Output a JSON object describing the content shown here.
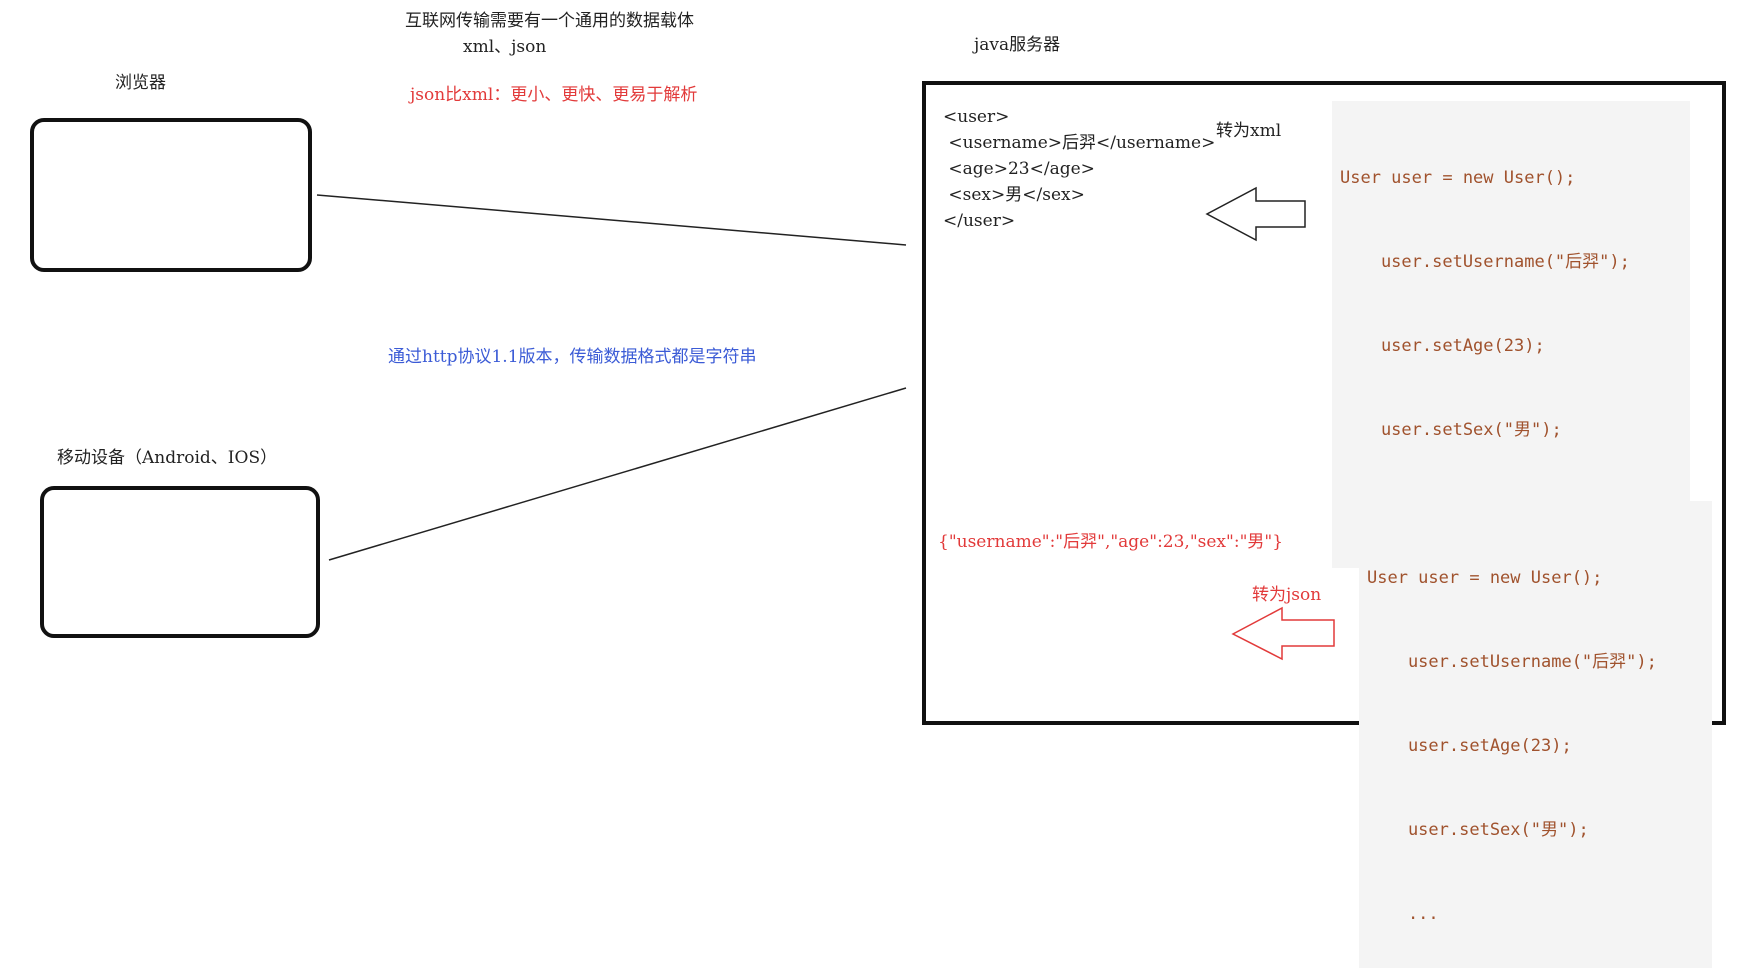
{
  "header": {
    "line1": "互联网传输需要有一个通用的数据载体",
    "line2": "xml、json",
    "comparison": "json比xml：更小、更快、更易于解析"
  },
  "server": {
    "title": "java服务器"
  },
  "browser": {
    "label": "浏览器"
  },
  "mobile": {
    "label": "移动设备（Android、IOS）"
  },
  "transport_note": "通过http协议1.1版本，传输数据格式都是字符串",
  "xml_block": {
    "lines": [
      "<user>",
      " <username>后羿</username>",
      " <age>23</age>",
      " <sex>男</sex>",
      "</user>"
    ]
  },
  "to_xml_label": "转为xml",
  "to_json_label": "转为json",
  "json_string": "{\"username\":\"后羿\",\"age\":23,\"sex\":\"男\"}",
  "code_top": {
    "lines": [
      "User user = new User();",
      "    user.setUsername(\"后羿\");",
      "    user.setAge(23);",
      "    user.setSex(\"男\");",
      "    ..."
    ]
  },
  "code_bottom": {
    "lines": [
      "User user = new User();",
      "    user.setUsername(\"后羿\");",
      "    user.setAge(23);",
      "    user.setSex(\"男\");",
      "    ..."
    ]
  },
  "colors": {
    "red_note": "#e23a3a",
    "blue_note": "#3b5bd6",
    "code_text": "#a0522d",
    "code_bg": "#f4f4f4"
  }
}
